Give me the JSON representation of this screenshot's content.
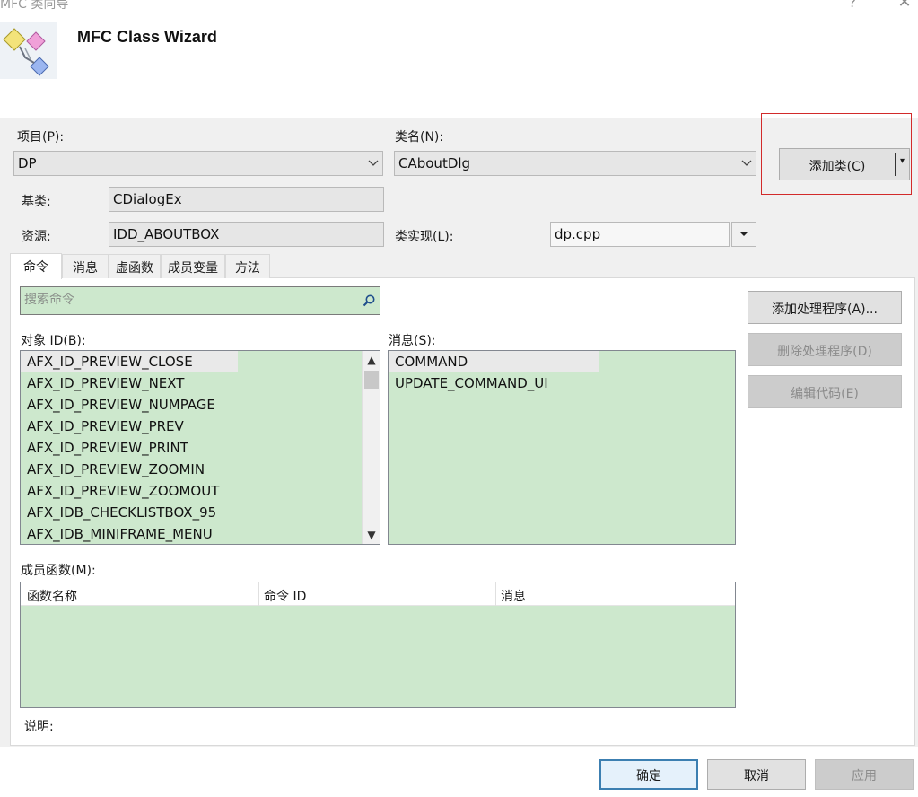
{
  "window": {
    "title": "MFC 类向导",
    "help_glyph": "?",
    "close_glyph": "✕"
  },
  "header": {
    "heading": "MFC Class Wizard"
  },
  "project": {
    "label": "项目(P):",
    "value": "DP"
  },
  "classname": {
    "label": "类名(N):",
    "value": "CAboutDlg"
  },
  "add_class": {
    "label": "添加类(C)",
    "arrow": "▾"
  },
  "base_class": {
    "label": "基类:",
    "value": "CDialogEx"
  },
  "resource": {
    "label": "资源:",
    "value": "IDD_ABOUTBOX"
  },
  "class_impl": {
    "label": "类实现(L):",
    "value": "dp.cpp"
  },
  "tabs": [
    {
      "label": "命令"
    },
    {
      "label": "消息"
    },
    {
      "label": "虚函数"
    },
    {
      "label": "成员变量"
    },
    {
      "label": "方法"
    }
  ],
  "search": {
    "placeholder": "搜索命令"
  },
  "object_ids": {
    "label": "对象 ID(B):",
    "items": [
      "AFX_ID_PREVIEW_CLOSE",
      "AFX_ID_PREVIEW_NEXT",
      "AFX_ID_PREVIEW_NUMPAGE",
      "AFX_ID_PREVIEW_PREV",
      "AFX_ID_PREVIEW_PRINT",
      "AFX_ID_PREVIEW_ZOOMIN",
      "AFX_ID_PREVIEW_ZOOMOUT",
      "AFX_IDB_CHECKLISTBOX_95",
      "AFX_IDB_MINIFRAME_MENU"
    ],
    "scroll_up": "▲",
    "scroll_down": "▼"
  },
  "messages": {
    "label": "消息(S):",
    "items": [
      "COMMAND",
      "UPDATE_COMMAND_UI"
    ]
  },
  "actions": {
    "add_handler": "添加处理程序(A)...",
    "delete_handler": "删除处理程序(D)",
    "edit_code": "编辑代码(E)"
  },
  "member_functions": {
    "label": "成员函数(M):",
    "columns": [
      "函数名称",
      "命令 ID",
      "消息"
    ]
  },
  "description": {
    "label": "说明:"
  },
  "footer": {
    "ok": "确定",
    "cancel": "取消",
    "apply": "应用"
  },
  "colors": {
    "list_background": "#cde8cd",
    "panel_background": "#f0f0f0",
    "highlight_border": "#d22a2a",
    "default_button_border": "#3c7fb1"
  }
}
